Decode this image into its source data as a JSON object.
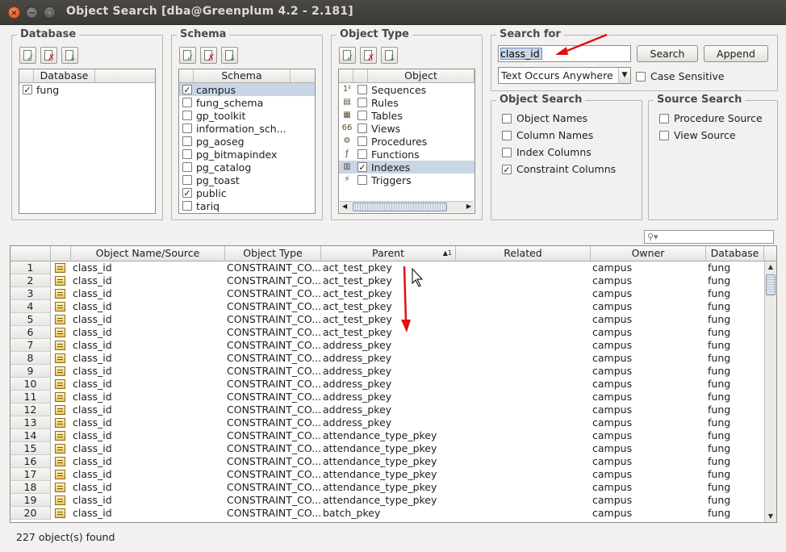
{
  "window": {
    "title": "Object Search [dba@Greenplum 4.2 - 2.181]"
  },
  "database": {
    "legend": "Database",
    "column": "Database",
    "items": [
      {
        "label": "fung",
        "checked": true
      }
    ]
  },
  "schema": {
    "legend": "Schema",
    "column": "Schema",
    "items": [
      {
        "label": "campus",
        "checked": true,
        "selected": true
      },
      {
        "label": "fung_schema",
        "checked": false
      },
      {
        "label": "gp_toolkit",
        "checked": false
      },
      {
        "label": "information_sch...",
        "checked": false
      },
      {
        "label": "pg_aoseg",
        "checked": false
      },
      {
        "label": "pg_bitmapindex",
        "checked": false
      },
      {
        "label": "pg_catalog",
        "checked": false
      },
      {
        "label": "pg_toast",
        "checked": false
      },
      {
        "label": "public",
        "checked": true
      },
      {
        "label": "tariq",
        "checked": false
      }
    ]
  },
  "object_type": {
    "legend": "Object Type",
    "column": "Object",
    "items": [
      {
        "label": "Sequences",
        "checked": false,
        "icon": "sequence-icon"
      },
      {
        "label": "Rules",
        "checked": false,
        "icon": "rule-icon"
      },
      {
        "label": "Tables",
        "checked": false,
        "icon": "table-icon"
      },
      {
        "label": "Views",
        "checked": false,
        "icon": "view-icon"
      },
      {
        "label": "Procedures",
        "checked": false,
        "icon": "procedure-icon"
      },
      {
        "label": "Functions",
        "checked": false,
        "icon": "function-icon"
      },
      {
        "label": "Indexes",
        "checked": true,
        "icon": "index-icon",
        "selected": true
      },
      {
        "label": "Triggers",
        "checked": false,
        "icon": "trigger-icon"
      }
    ]
  },
  "search_for": {
    "legend": "Search for",
    "value": "class_id",
    "search_button": "Search",
    "append_button": "Append",
    "mode": "Text Occurs Anywhere",
    "case_sensitive": "Case Sensitive"
  },
  "object_search": {
    "legend": "Object Search",
    "options": [
      {
        "label": "Object Names",
        "checked": false
      },
      {
        "label": "Column Names",
        "checked": false
      },
      {
        "label": "Index Columns",
        "checked": false
      },
      {
        "label": "Constraint Columns",
        "checked": true
      }
    ]
  },
  "source_search": {
    "legend": "Source Search",
    "options": [
      {
        "label": "Procedure Source",
        "checked": false
      },
      {
        "label": "View Source",
        "checked": false
      }
    ]
  },
  "results": {
    "columns": [
      "Object Name/Source",
      "Object Type",
      "Parent",
      "Related",
      "Owner",
      "Database"
    ],
    "sort_marker": "1",
    "rows": [
      {
        "n": "1",
        "name": "class_id",
        "type": "CONSTRAINT_CO...",
        "parent": "act_test_pkey",
        "related": "",
        "owner": "campus",
        "db": "fung"
      },
      {
        "n": "2",
        "name": "class_id",
        "type": "CONSTRAINT_CO...",
        "parent": "act_test_pkey",
        "related": "",
        "owner": "campus",
        "db": "fung"
      },
      {
        "n": "3",
        "name": "class_id",
        "type": "CONSTRAINT_CO...",
        "parent": "act_test_pkey",
        "related": "",
        "owner": "campus",
        "db": "fung"
      },
      {
        "n": "4",
        "name": "class_id",
        "type": "CONSTRAINT_CO...",
        "parent": "act_test_pkey",
        "related": "",
        "owner": "campus",
        "db": "fung"
      },
      {
        "n": "5",
        "name": "class_id",
        "type": "CONSTRAINT_CO...",
        "parent": "act_test_pkey",
        "related": "",
        "owner": "campus",
        "db": "fung"
      },
      {
        "n": "6",
        "name": "class_id",
        "type": "CONSTRAINT_CO...",
        "parent": "act_test_pkey",
        "related": "",
        "owner": "campus",
        "db": "fung"
      },
      {
        "n": "7",
        "name": "class_id",
        "type": "CONSTRAINT_CO...",
        "parent": "address_pkey",
        "related": "",
        "owner": "campus",
        "db": "fung"
      },
      {
        "n": "8",
        "name": "class_id",
        "type": "CONSTRAINT_CO...",
        "parent": "address_pkey",
        "related": "",
        "owner": "campus",
        "db": "fung"
      },
      {
        "n": "9",
        "name": "class_id",
        "type": "CONSTRAINT_CO...",
        "parent": "address_pkey",
        "related": "",
        "owner": "campus",
        "db": "fung"
      },
      {
        "n": "10",
        "name": "class_id",
        "type": "CONSTRAINT_CO...",
        "parent": "address_pkey",
        "related": "",
        "owner": "campus",
        "db": "fung"
      },
      {
        "n": "11",
        "name": "class_id",
        "type": "CONSTRAINT_CO...",
        "parent": "address_pkey",
        "related": "",
        "owner": "campus",
        "db": "fung"
      },
      {
        "n": "12",
        "name": "class_id",
        "type": "CONSTRAINT_CO...",
        "parent": "address_pkey",
        "related": "",
        "owner": "campus",
        "db": "fung"
      },
      {
        "n": "13",
        "name": "class_id",
        "type": "CONSTRAINT_CO...",
        "parent": "address_pkey",
        "related": "",
        "owner": "campus",
        "db": "fung"
      },
      {
        "n": "14",
        "name": "class_id",
        "type": "CONSTRAINT_CO...",
        "parent": "attendance_type_pkey",
        "related": "",
        "owner": "campus",
        "db": "fung"
      },
      {
        "n": "15",
        "name": "class_id",
        "type": "CONSTRAINT_CO...",
        "parent": "attendance_type_pkey",
        "related": "",
        "owner": "campus",
        "db": "fung"
      },
      {
        "n": "16",
        "name": "class_id",
        "type": "CONSTRAINT_CO...",
        "parent": "attendance_type_pkey",
        "related": "",
        "owner": "campus",
        "db": "fung"
      },
      {
        "n": "17",
        "name": "class_id",
        "type": "CONSTRAINT_CO...",
        "parent": "attendance_type_pkey",
        "related": "",
        "owner": "campus",
        "db": "fung"
      },
      {
        "n": "18",
        "name": "class_id",
        "type": "CONSTRAINT_CO...",
        "parent": "attendance_type_pkey",
        "related": "",
        "owner": "campus",
        "db": "fung"
      },
      {
        "n": "19",
        "name": "class_id",
        "type": "CONSTRAINT_CO...",
        "parent": "attendance_type_pkey",
        "related": "",
        "owner": "campus",
        "db": "fung"
      },
      {
        "n": "20",
        "name": "class_id",
        "type": "CONSTRAINT_CO...",
        "parent": "batch_pkey",
        "related": "",
        "owner": "campus",
        "db": "fung"
      }
    ]
  },
  "status": {
    "text": "227 object(s) found"
  },
  "colors": {
    "selection": "#c9d6e6",
    "annotation_arrow": "#e01010",
    "titlebar": "#3c3b37",
    "close_button": "#e0531e"
  }
}
